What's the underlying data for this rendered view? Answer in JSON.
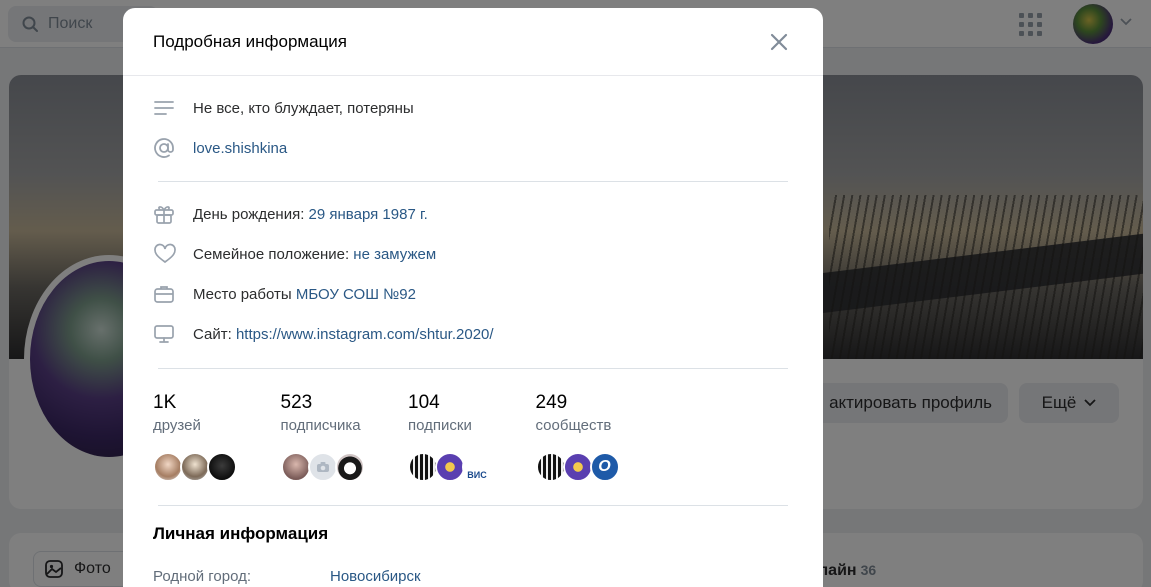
{
  "topbar": {
    "search_placeholder": "Поиск"
  },
  "profile": {
    "edit_label": "Редактировать профиль",
    "edit_visible": "актировать профиль",
    "more_label": "Ещё",
    "photo_label": "Фото",
    "online_label": "лайн",
    "online_count": "36"
  },
  "modal": {
    "title": "Подробная информация",
    "status": "Не все, кто блуждает, потеряны",
    "nickname": "love.shishkina",
    "birthday_key": "День рождения:",
    "birthday_val": "29 января 1987 г.",
    "family_key": "Семейное положение:",
    "family_val": "не замужем",
    "work_key": "Место работы",
    "work_val": "МБОУ СОШ №92",
    "site_key": "Сайт:",
    "site_val": "https://www.instagram.com/shtur.2020/",
    "counters": [
      {
        "num": "1K",
        "label": "друзей"
      },
      {
        "num": "523",
        "label": "подписчика"
      },
      {
        "num": "104",
        "label": "подписки"
      },
      {
        "num": "249",
        "label": "сообществ"
      }
    ],
    "personal_title": "Личная информация",
    "hometown_key": "Родной город:",
    "hometown_val": "Новосибирск",
    "brand_text": "ВИС",
    "brand_text_2": "О"
  },
  "colors": {
    "link": "#2a5885",
    "text": "#2c2d2e",
    "secondary": "#626d7a",
    "icon": "#99a2ad"
  }
}
